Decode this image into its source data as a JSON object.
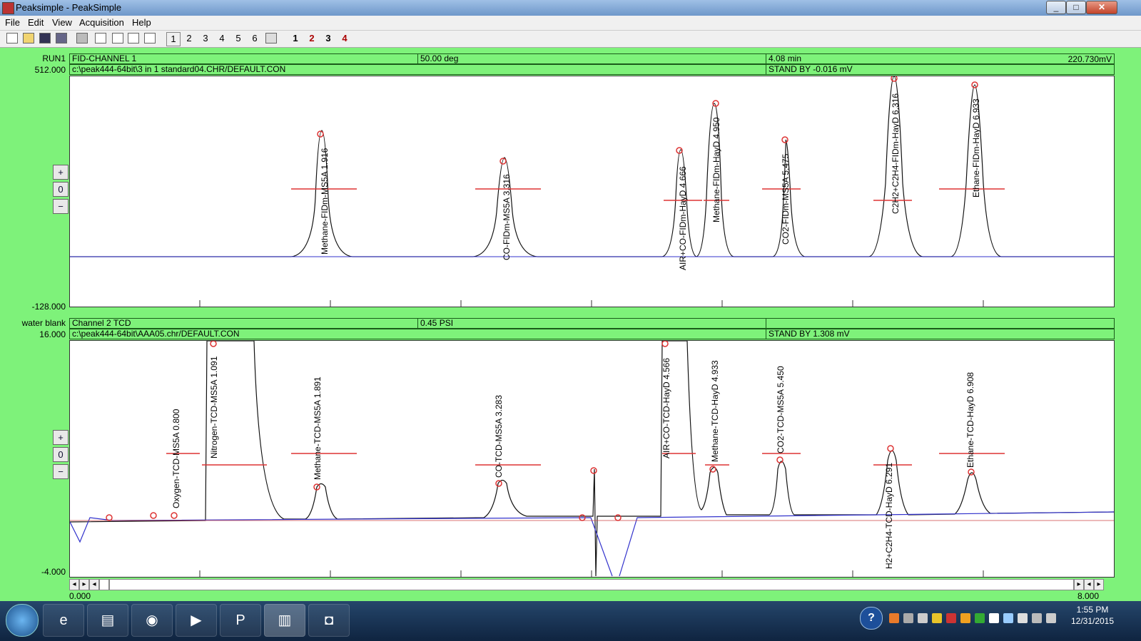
{
  "window": {
    "title": "Peaksimple - PeakSimple",
    "minimize": "_",
    "maximize": "□",
    "close": "✕"
  },
  "menu": [
    "File",
    "Edit",
    "View",
    "Acquisition",
    "Help"
  ],
  "toolbar": {
    "channels": [
      "1",
      "2",
      "3",
      "4",
      "5",
      "6"
    ],
    "multi": [
      "1",
      "2",
      "3",
      "4"
    ]
  },
  "panel1": {
    "run_label": "RUN1",
    "ymax": "512.000",
    "ymin": "-128.000",
    "channel": "FID-CHANNEL 1",
    "temp": "50.00 deg",
    "time": "4.08 min",
    "signal": "220.730mV",
    "file": "c:\\peak444-64bit\\3 in 1 standard04.CHR/DEFAULT.CON",
    "standby": "STAND BY -0.016 mV",
    "peaks": [
      {
        "label": "Methane-FIDm-MS5A 1.916"
      },
      {
        "label": "CO-FIDm-MS5A 3.316"
      },
      {
        "label": "AIR+CO-FIDm-HayD 4.666"
      },
      {
        "label": "Methane-FIDm-HayD 4.950"
      },
      {
        "label": "CO2-FIDm-MS5A 5.475"
      },
      {
        "label": "C2H2+C2H4-FIDm-HayD 6.316"
      },
      {
        "label": "Ethane-FIDm-HayD 6.933"
      }
    ]
  },
  "panel2": {
    "run_label": "water blank",
    "ymax": "16.000",
    "ymin": "-4.000",
    "channel": "Channel 2 TCD",
    "pressure": "0.45 PSI",
    "file": "c:\\peak444-64bit\\AAA05.chr/DEFAULT.CON",
    "standby": "STAND BY 1.308 mV",
    "peaks": [
      {
        "label": "Oxygen-TCD-MS5A 0.800"
      },
      {
        "label": "Nitrogen-TCD-MS5A 1.091"
      },
      {
        "label": "Methane-TCD-MS5A 1.891"
      },
      {
        "label": "CO-TCD-MS5A 3.283"
      },
      {
        "label": "AIR+CO-TCD-HayD 4.566"
      },
      {
        "label": "Methane-TCD-HayD 4.933"
      },
      {
        "label": "CO2-TCD-MS5A 5.450"
      },
      {
        "label": "H2+C2H4-TCD-HayD 6.291"
      },
      {
        "label": "Ethane-TCD-HayD 6.908"
      }
    ]
  },
  "xaxis": {
    "min": "0.000",
    "max": "8.000"
  },
  "zoom": {
    "in": "+",
    "reset": "0",
    "out": "−"
  },
  "taskbar": {
    "time": "1:55 PM",
    "date": "12/31/2015"
  }
}
